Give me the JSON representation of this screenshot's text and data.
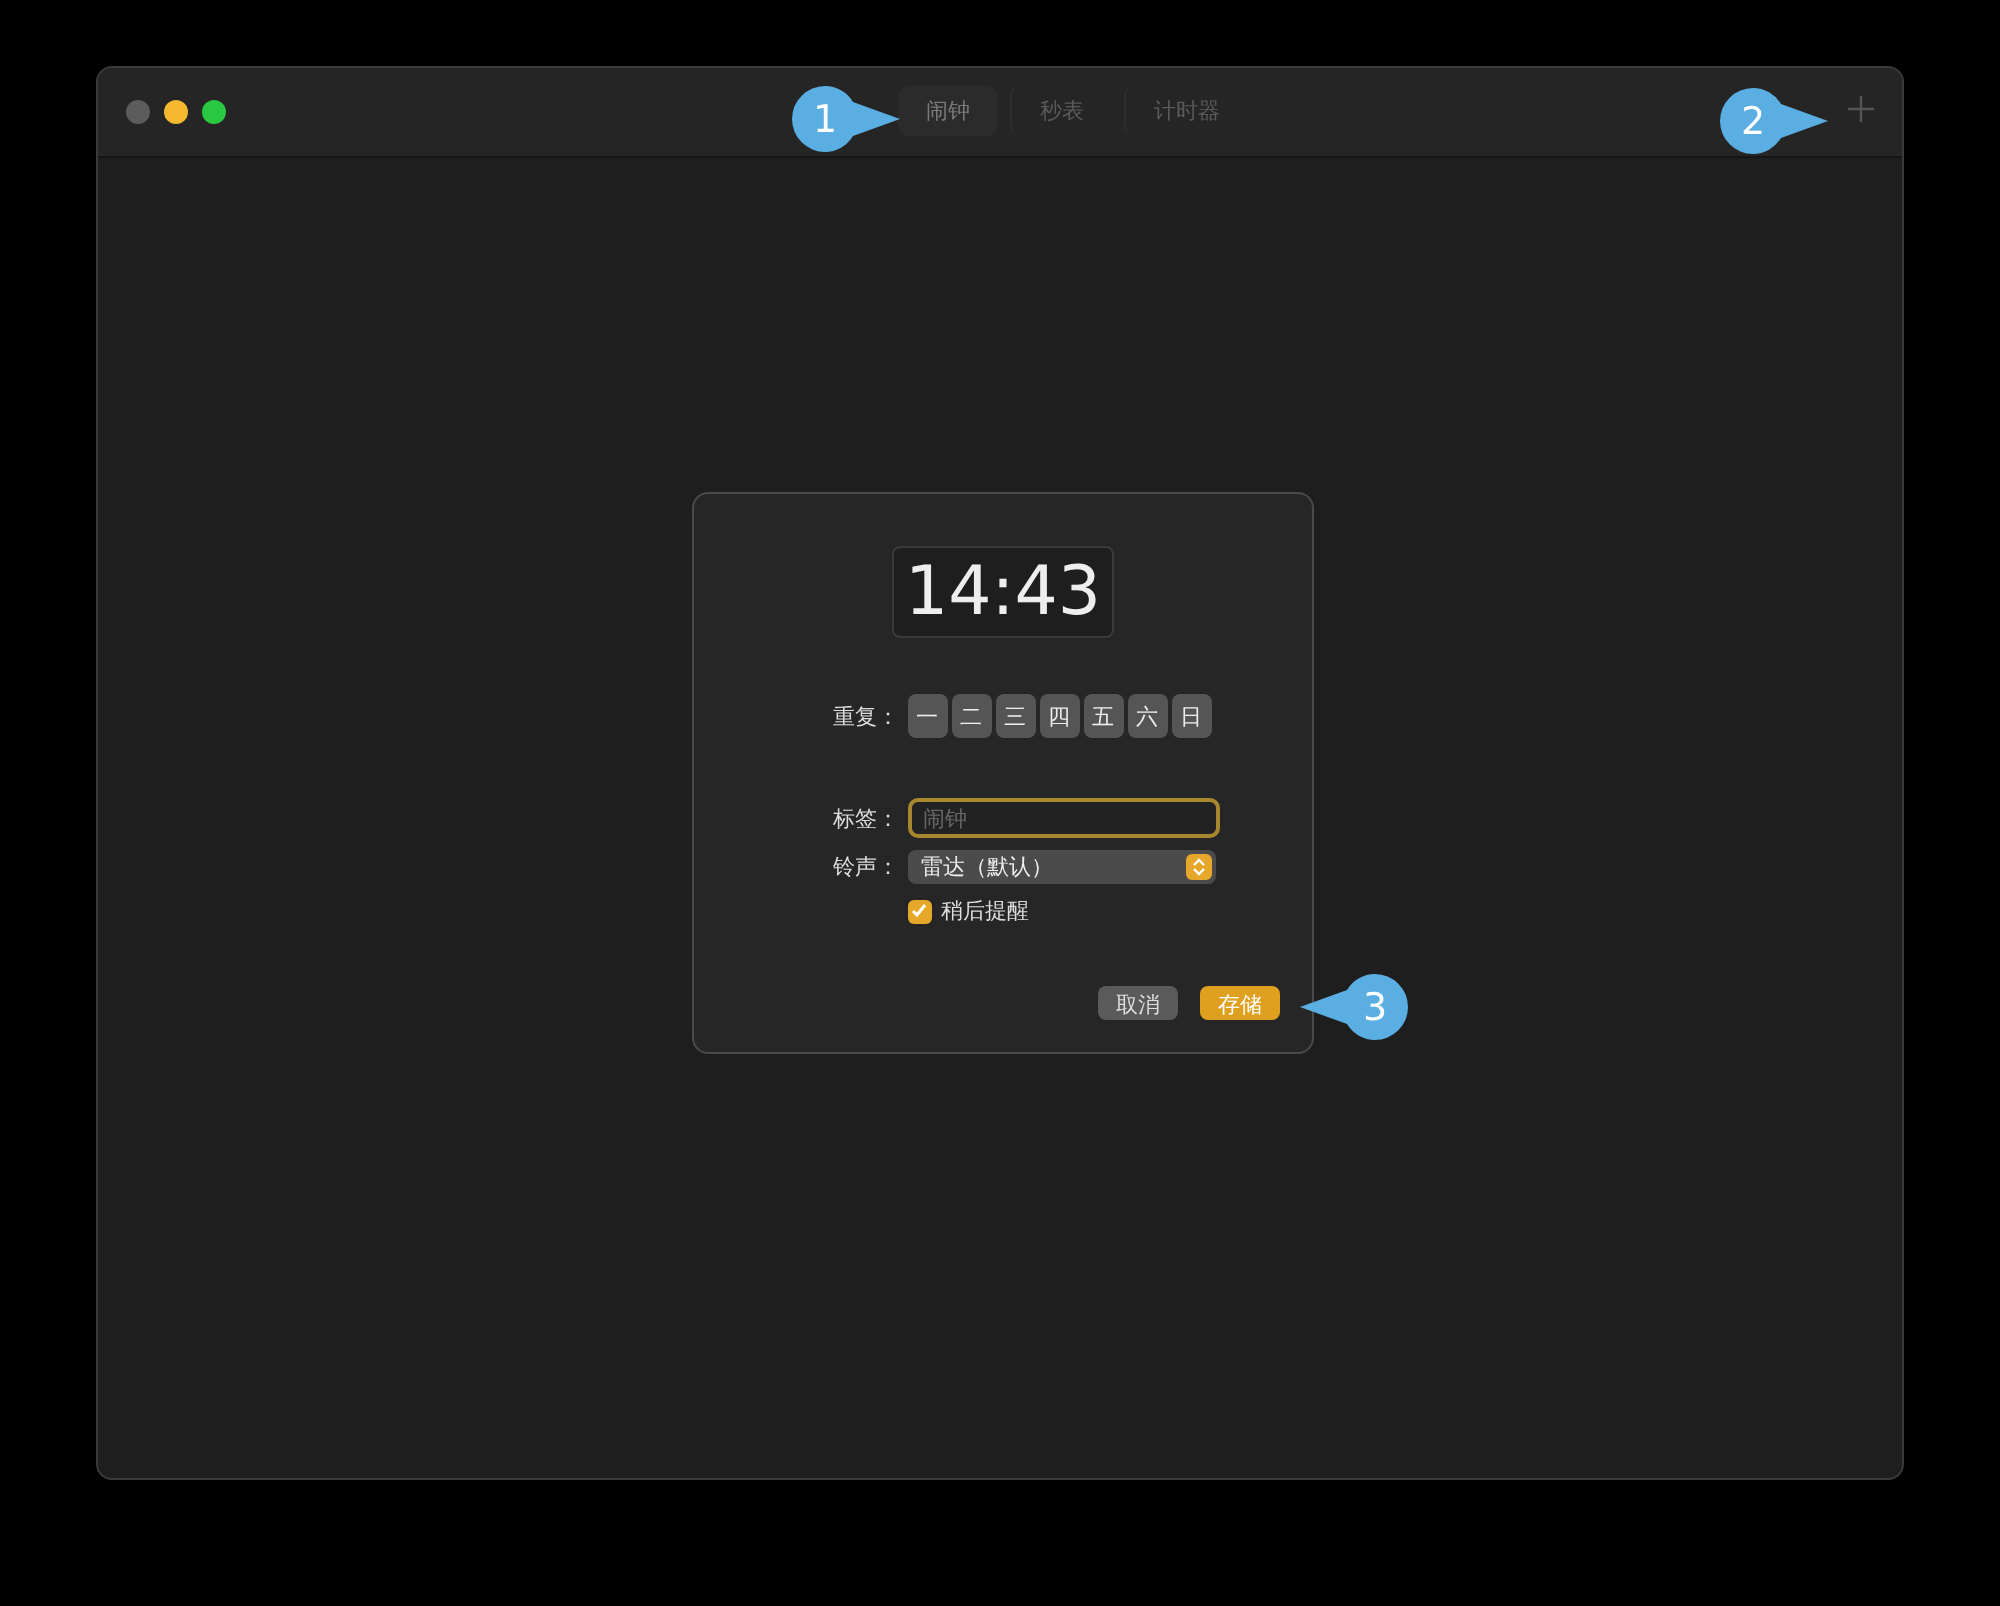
{
  "tabs": [
    {
      "label": "闹钟",
      "selected": true
    },
    {
      "label": "秒表",
      "selected": false
    },
    {
      "label": "计时器",
      "selected": false
    }
  ],
  "dialog": {
    "time": "14:43",
    "repeat": {
      "label": "重复：",
      "days": [
        "一",
        "二",
        "三",
        "四",
        "五",
        "六",
        "日"
      ]
    },
    "label_field": {
      "label": "标签：",
      "placeholder": "闹钟"
    },
    "sound": {
      "label": "铃声：",
      "value": "雷达（默认）"
    },
    "snooze": {
      "label": "稍后提醒",
      "checked": true
    },
    "buttons": [
      {
        "label": "取消",
        "kind": "secondary"
      },
      {
        "label": "存储",
        "kind": "primary"
      }
    ]
  },
  "callouts": [
    {
      "number": "1",
      "points_left": false
    },
    {
      "number": "2",
      "points_left": false
    },
    {
      "number": "3",
      "points_left": true
    }
  ]
}
